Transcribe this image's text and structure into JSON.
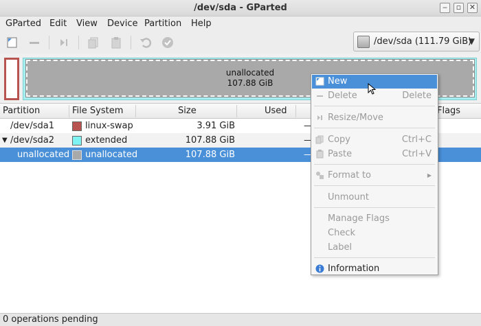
{
  "window": {
    "title": "/dev/sda - GParted"
  },
  "menu": [
    "GParted",
    "Edit",
    "View",
    "Device",
    "Partition",
    "Help"
  ],
  "toolbar": {
    "icons": [
      "new-icon",
      "delete-icon",
      "resize-move-icon",
      "copy-icon",
      "paste-icon",
      "undo-icon",
      "apply-icon"
    ],
    "device": "/dev/sda   (111.79 GiB)"
  },
  "map": {
    "unallocated_label": "unallocated",
    "unallocated_size": "107.88 GiB"
  },
  "columns": {
    "partition": "Partition",
    "filesystem": "File System",
    "size": "Size",
    "used": "Used",
    "flags": "Flags"
  },
  "rows": [
    {
      "partition": "/dev/sda1",
      "filesystem": "linux-swap",
      "size": "3.91 GiB",
      "used": "—",
      "color": "#b85450"
    },
    {
      "partition": "/dev/sda2",
      "filesystem": "extended",
      "size": "107.88 GiB",
      "used": "—",
      "color": "#7ff2f2",
      "expander": "▼"
    },
    {
      "partition": "unallocated",
      "filesystem": "unallocated",
      "size": "107.88 GiB",
      "used": "—",
      "color": "#a9a9a9"
    }
  ],
  "context_menu": {
    "new": "New",
    "delete": "Delete",
    "delete_acc": "Delete",
    "resize": "Resize/Move",
    "copy": "Copy",
    "copy_acc": "Ctrl+C",
    "paste": "Paste",
    "paste_acc": "Ctrl+V",
    "format": "Format to",
    "unmount": "Unmount",
    "manage_flags": "Manage Flags",
    "check": "Check",
    "label": "Label",
    "information": "Information"
  },
  "status": "0 operations pending",
  "colors": {
    "selection": "#4a90d9",
    "swap": "#b85450",
    "extended": "#a7eef0",
    "unallocated": "#a9a9a9"
  }
}
